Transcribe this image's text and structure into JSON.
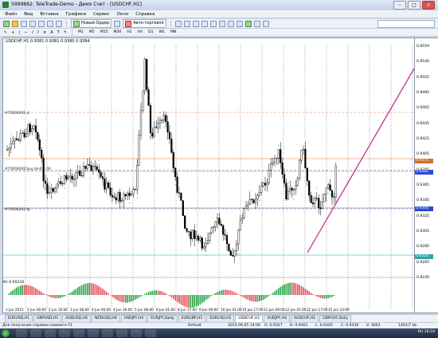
{
  "window": {
    "title": "5999862: TeleTrade-Demo - Демо Счет - [USDCHF,H1]"
  },
  "menu": [
    "Файл",
    "Вид",
    "Вставка",
    "Графики",
    "Сервис",
    "Окно",
    "Справка"
  ],
  "toolbar": {
    "new_order": "Новый Ордер",
    "autotrade": "Авто-торговля"
  },
  "timeframes": [
    "M1",
    "M5",
    "M15",
    "M30",
    "H1",
    "H4",
    "D1",
    "W1",
    "MN"
  ],
  "chart": {
    "title": "USDCHF,H1  0.9381 0.9381 0.9380 0.9384",
    "order_sl": "#75009292 sl",
    "order_buy": "#75009292 buy limit 1.00",
    "order_tp": "#75009292 tp",
    "price_axis": [
      "0.9559",
      "0.9540",
      "0.9505",
      "0.9485",
      "0.9465",
      "0.9445",
      "0.9425",
      "0.9405",
      "0.9385",
      "0.9365",
      "0.9345",
      "0.9325",
      "0.9305",
      "0.9285",
      "0.9265",
      "0.9245"
    ],
    "tags": [
      {
        "text": "0.9382",
        "color": "#2b4bd6"
      },
      {
        "text": "0.9375",
        "color": "#d07030"
      },
      {
        "text": "0.9344",
        "color": "#2b4bd6"
      },
      {
        "text": "0.9325",
        "color": "#2aa7a7"
      }
    ],
    "time_axis": [
      "1 Jun 2015",
      "2 Jun 00:00",
      "2 Jun 16:00",
      "3 Jun 08:00",
      "4 Jun 00:00",
      "4 Jun 16:00",
      "5 Jun 08:00",
      "8 Jun 01:00",
      "8 Jun 17:00",
      "9 Jun 09:00",
      "10 Jun 01:00",
      "10 Jun 17:00",
      "11 Jun 09:00",
      "12 Jun 01:00",
      "12 Jun 17:00",
      "15 Jun 10:00"
    ],
    "osc_label": "AO 0.00234",
    "osc_scale": [
      "0.00",
      "0.00"
    ]
  },
  "tabs": [
    "EURUSD,H1",
    "GBPUSD,H1",
    "AUDUSD,H4",
    "NZDUSD,H4",
    "USDJPY,H4",
    "EURJPY,Daily",
    "EURGBP,H1",
    "EURCAD,H1",
    "USDCHF,H1",
    "AUDJPY,H4",
    "AUDCHF,H1",
    "GBPCHF,Daily"
  ],
  "active_tab": "USDCHF,H1",
  "status": {
    "help": "Для получения справки нажмите F1",
    "profile": "Default",
    "datetime": "2015.06.05 14:00",
    "o": "O: 0.9327",
    "h": "H: 0.9361",
    "l": "L: 0.9320",
    "c": "C: 0.9339",
    "v": "V: 3603",
    "traffic": "1461/7 kb"
  },
  "tray": {
    "lang": "RU",
    "time": "16:24"
  }
}
